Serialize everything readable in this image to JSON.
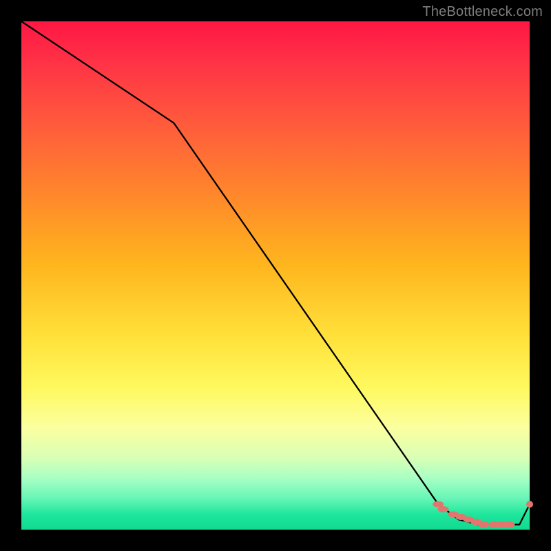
{
  "attribution": "TheBottleneck.com",
  "colors": {
    "frame": "#000000",
    "line": "#000000",
    "marker": "#e2766e"
  },
  "chart_data": {
    "type": "line",
    "title": "",
    "xlabel": "",
    "ylabel": "",
    "xlim": [
      0,
      100
    ],
    "ylim": [
      0,
      100
    ],
    "grid": false,
    "series": [
      {
        "name": "curve",
        "x": [
          0,
          30,
          82,
          86,
          90,
          94,
          98,
          100
        ],
        "y": [
          100,
          80,
          5,
          2,
          1,
          1,
          1,
          5
        ]
      }
    ],
    "markers": {
      "name": "highlight-points",
      "x": [
        82,
        83,
        85,
        86.5,
        88,
        89.5,
        91,
        93,
        94.5,
        96,
        100
      ],
      "y": [
        5,
        4,
        3,
        2.5,
        2,
        1.5,
        1,
        1,
        1,
        1,
        5
      ]
    }
  }
}
